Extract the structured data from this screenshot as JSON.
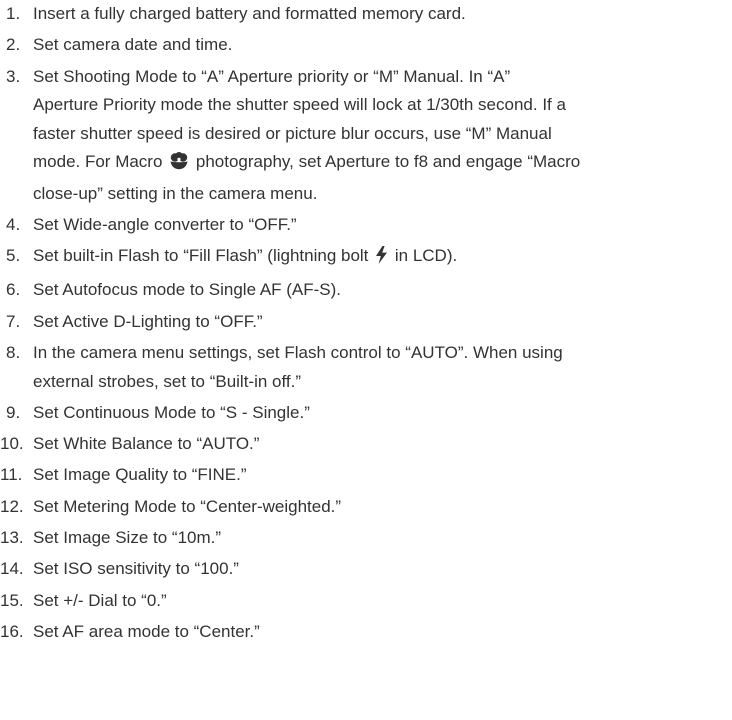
{
  "steps": [
    {
      "num": "1.",
      "lines": [
        [
          "Insert a fully charged battery and formatted memory card."
        ]
      ]
    },
    {
      "num": "2.",
      "lines": [
        [
          "Set camera date and time."
        ]
      ]
    },
    {
      "num": "3.",
      "lines": [
        [
          "Set Shooting Mode to “A” Aperture priority or “M” Manual. In “A”"
        ],
        [
          "Aperture Priority mode the shutter speed will lock at 1/30th second. If a"
        ],
        [
          "faster shutter speed is desired or picture blur occurs, use “M” Manual"
        ],
        [
          "mode. For Macro ",
          {
            "icon": "macro-flower-icon"
          },
          " photography, set Aperture to f8 and engage “Macro"
        ],
        [
          "close-up” setting in the camera menu."
        ]
      ]
    },
    {
      "num": "4.",
      "lines": [
        [
          "Set Wide-angle converter to “OFF.”"
        ]
      ]
    },
    {
      "num": "5.",
      "lines": [
        [
          "Set built-in Flash to “Fill Flash” (lightning bolt ",
          {
            "icon": "lightning-bolt-icon"
          },
          " in LCD)."
        ]
      ]
    },
    {
      "num": "6.",
      "lines": [
        [
          "Set Autofocus mode to Single AF (AF-S)."
        ]
      ]
    },
    {
      "num": "7.",
      "lines": [
        [
          "Set Active D-Lighting to “OFF.”"
        ]
      ]
    },
    {
      "num": "8.",
      "lines": [
        [
          "In the camera menu settings, set Flash control to “AUTO”. When using"
        ],
        [
          "external strobes, set to “Built-in off.”"
        ]
      ]
    },
    {
      "num": "9.",
      "lines": [
        [
          "Set Continuous Mode to “S - Single.”"
        ]
      ]
    },
    {
      "num": "10.",
      "lines": [
        [
          "Set White Balance to “AUTO.”"
        ]
      ]
    },
    {
      "num": "11.",
      "lines": [
        [
          "Set Image Quality to “FINE.”"
        ]
      ]
    },
    {
      "num": "12.",
      "lines": [
        [
          "Set Metering Mode to “Center-weighted.”"
        ]
      ]
    },
    {
      "num": "13.",
      "lines": [
        [
          "Set Image Size to “10m.”"
        ]
      ]
    },
    {
      "num": "14.",
      "lines": [
        [
          "Set ISO sensitivity to “100.”"
        ]
      ]
    },
    {
      "num": "15.",
      "lines": [
        [
          "Set +/- Dial to “0.”"
        ]
      ]
    },
    {
      "num": "16.",
      "lines": [
        [
          "Set AF area mode to “Center.”"
        ]
      ]
    }
  ]
}
